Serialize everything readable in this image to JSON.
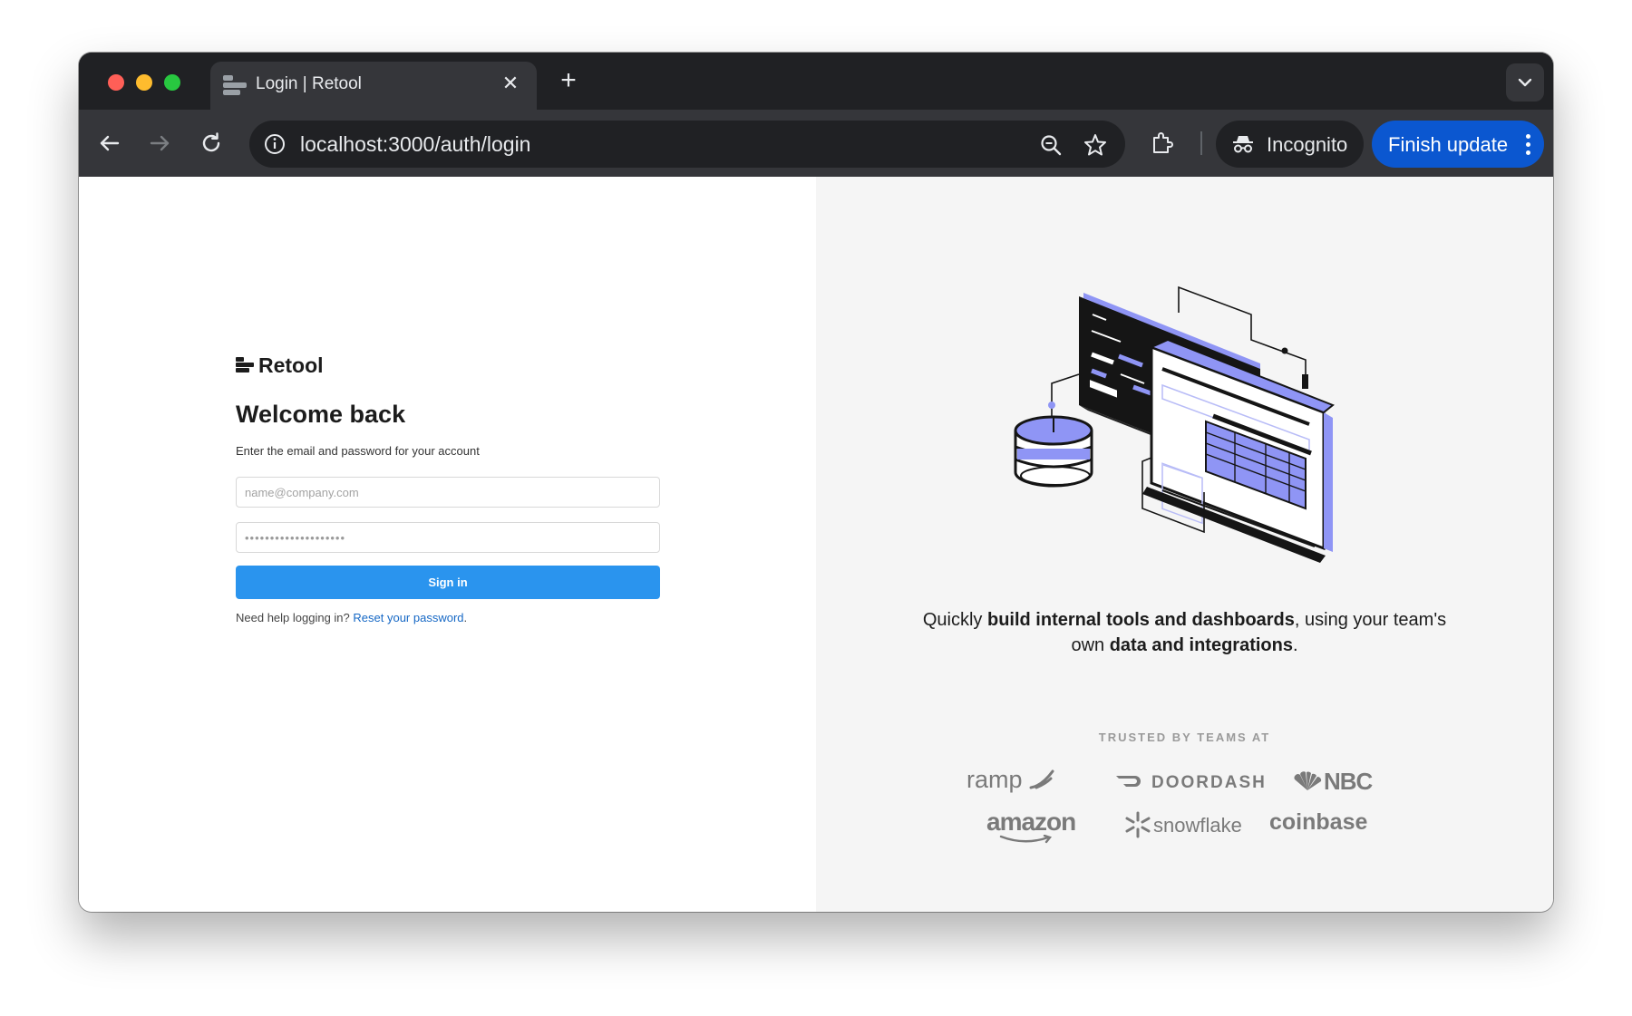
{
  "browser": {
    "tab_title": "Login | Retool",
    "tab_close": "✕",
    "new_tab": "+",
    "url": "localhost:3000/auth/login",
    "incognito_label": "Incognito",
    "finish_update_label": "Finish update"
  },
  "login": {
    "brand": "Retool",
    "heading": "Welcome back",
    "subtitle": "Enter the email and password for your account",
    "email_placeholder": "name@company.com",
    "password_placeholder": "••••••••••••••••••••",
    "signin_label": "Sign in",
    "help_text": "Need help logging in? ",
    "reset_link": "Reset your password",
    "help_suffix": "."
  },
  "marketing": {
    "tagline_1": "Quickly ",
    "tagline_2": "build internal tools and dashboards",
    "tagline_3": ", using your team's own ",
    "tagline_4": "data and integrations",
    "tagline_5": ".",
    "trusted_by": "TRUSTED BY TEAMS AT",
    "logos": [
      "ramp",
      "DOORDASH",
      "NBC",
      "amazon",
      "snowflake",
      "coinbase"
    ]
  },
  "colors": {
    "accent": "#2a94ee",
    "update_button": "#0b57d0",
    "illustration_purple": "#8f95f5"
  }
}
